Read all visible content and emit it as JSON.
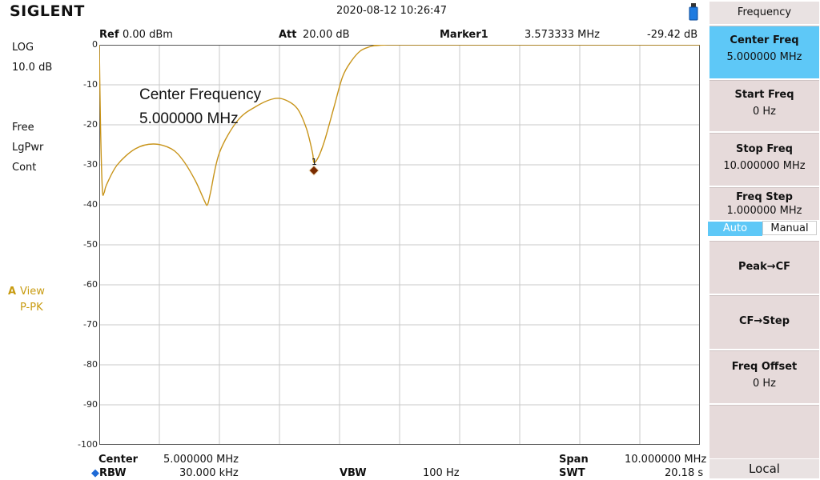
{
  "header": {
    "brand": "SIGLENT",
    "datetime": "2020-08-12   10:26:47",
    "ref_label": "Ref",
    "ref_value": "0.00 dBm",
    "att_label": "Att",
    "att_value": "20.00 dB",
    "marker_label": "Marker1",
    "marker_freq": "3.573333 MHz",
    "marker_level": "-29.42 dB"
  },
  "left": {
    "scale_type": "LOG",
    "scale_div": "10.0 dB",
    "trig": "Free",
    "det": "LgPwr",
    "sweep": "Cont",
    "trace_id": "A",
    "trace_mode": "View",
    "trace_det": "P-PK"
  },
  "annotation": {
    "line1": "Center Frequency",
    "line2": "5.000000 MHz"
  },
  "yticks": [
    "0",
    "-10",
    "-20",
    "-30",
    "-40",
    "-50",
    "-60",
    "-70",
    "-80",
    "-90",
    "-100"
  ],
  "marker_number": "1",
  "footer": {
    "center_label": "Center",
    "center_value": "5.000000 MHz",
    "rbw_label": "RBW",
    "rbw_value": "30.000 kHz",
    "vbw_label": "VBW",
    "vbw_value": "100 Hz",
    "span_label": "Span",
    "span_value": "10.000000 MHz",
    "swt_label": "SWT",
    "swt_value": "20.18 s"
  },
  "panel": {
    "title": "Frequency",
    "center_freq": {
      "label": "Center Freq",
      "value": "5.000000 MHz"
    },
    "start_freq": {
      "label": "Start Freq",
      "value": "0 Hz"
    },
    "stop_freq": {
      "label": "Stop Freq",
      "value": "10.000000 MHz"
    },
    "freq_step": {
      "label": "Freq Step",
      "value": "1.000000 MHz"
    },
    "auto": "Auto",
    "manual": "Manual",
    "peak_cf": "Peak→CF",
    "cf_step": "CF→Step",
    "freq_offset": {
      "label": "Freq Offset",
      "value": "0 Hz"
    },
    "local": "Local"
  },
  "colors": {
    "trace": "#c8941a",
    "active_key": "#5ec8f7",
    "marker": "#7a2b00",
    "grid": "#c8c8c8"
  },
  "chart_data": {
    "type": "line",
    "x_unit": "MHz",
    "y_unit": "dB",
    "xlim": [
      0,
      10
    ],
    "ylim": [
      -100,
      0
    ],
    "x": [
      0.0,
      0.02,
      0.05,
      0.08,
      0.12,
      0.3,
      0.6,
      0.9,
      1.2,
      1.4,
      1.6,
      1.75,
      1.8,
      1.85,
      2.0,
      2.3,
      2.6,
      2.9,
      3.1,
      3.3,
      3.45,
      3.55,
      3.573,
      3.65,
      3.75,
      3.9,
      4.05,
      4.2,
      4.35,
      4.5,
      4.6,
      4.8,
      5.0,
      10.0
    ],
    "y": [
      0,
      -20,
      -36,
      -37,
      -35,
      -30,
      -26,
      -24.8,
      -26,
      -29,
      -34,
      -39,
      -40,
      -37,
      -27,
      -19,
      -15.5,
      -13.5,
      -13.8,
      -16,
      -21,
      -27,
      -29.42,
      -28,
      -24,
      -16,
      -8,
      -4,
      -1.5,
      -0.5,
      -0.2,
      0,
      0,
      0
    ],
    "marker": {
      "x": 3.573333,
      "y": -29.42
    }
  }
}
